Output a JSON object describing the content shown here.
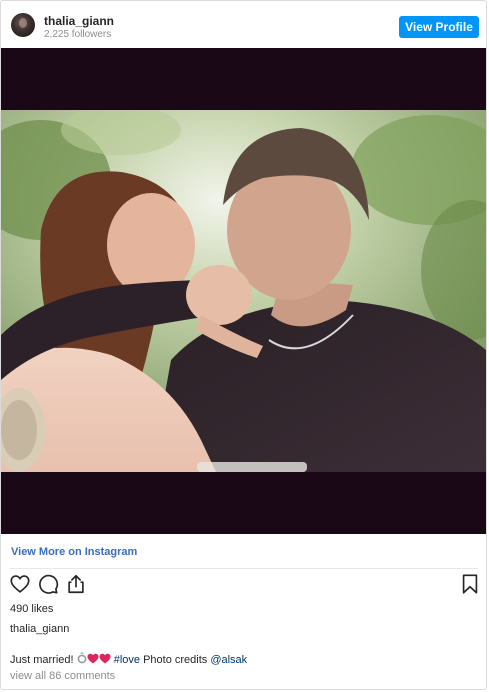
{
  "header": {
    "username": "thalia_giann",
    "followers": "2,225 followers",
    "view_profile_label": "View Profile"
  },
  "post": {
    "view_more_label": "View More on Instagram",
    "likes": "490 likes",
    "author": "thalia_giann",
    "caption": {
      "text": "Just married!",
      "emojis": [
        "ring",
        "red-heart",
        "red-heart"
      ],
      "hashtag": "#love",
      "credit_text": "Photo credits",
      "mention": "@alsak"
    },
    "comments_label": "view all 86 comments"
  },
  "icons": {
    "like": "heart-outline-icon",
    "comment": "speech-bubble-icon",
    "share": "share-upload-icon",
    "save": "bookmark-icon"
  },
  "colors": {
    "accent": "#0095f6",
    "link": "#3b6eb6",
    "hashtag": "#00376b",
    "letterbox": "#1b0816"
  }
}
